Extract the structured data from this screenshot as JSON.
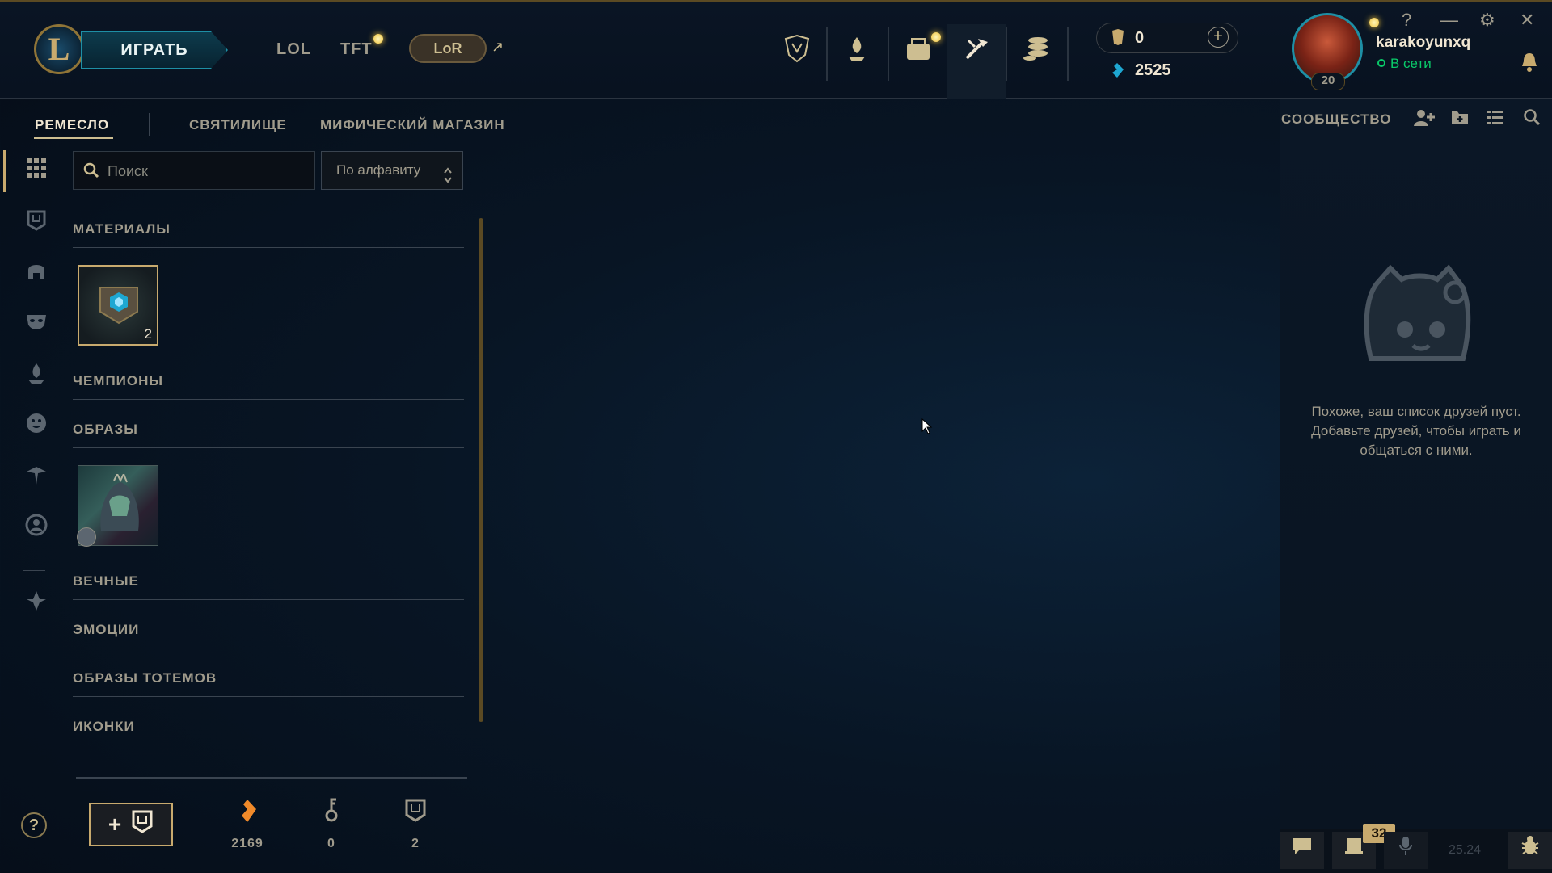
{
  "header": {
    "play_label": "ИГРАТЬ",
    "logo_letter": "L",
    "nav": [
      "LOL",
      "TFT"
    ],
    "lor_label": "LoR",
    "external_arrow": "↗",
    "icons": [
      "worlds-icon",
      "champion-mastery-icon",
      "loot-icon",
      "crafting-icon",
      "store-icon"
    ],
    "rp": "0",
    "be": "2525"
  },
  "profile": {
    "name": "karakoyunxq",
    "status": "В сети",
    "level": "20"
  },
  "window_controls": {
    "help": "?",
    "minimize": "—",
    "settings": "⚙",
    "close": "✕"
  },
  "subnav": {
    "tabs": [
      "РЕМЕСЛО",
      "СВЯТИЛИЩЕ",
      "МИФИЧЕСКИЙ МАГАЗИН"
    ],
    "active": "РЕМЕСЛО"
  },
  "search": {
    "placeholder": "Поиск"
  },
  "sort": {
    "selected": "По алфавиту"
  },
  "sections": {
    "materials": "МАТЕРИАЛЫ",
    "materials_count": "2",
    "champions": "ЧЕМПИОНЫ",
    "skins": "ОБРАЗЫ",
    "eternals": "ВЕЧНЫЕ",
    "emotes": "ЭМОЦИИ",
    "ward_skins": "ОБРАЗЫ ТОТЕМОВ",
    "icons": "ИКОНКИ"
  },
  "footer": {
    "add_label": "+",
    "help": "?",
    "stats": [
      {
        "name": "orange-essence",
        "value": "2169",
        "color": "#f08a2a"
      },
      {
        "name": "keys",
        "value": "0",
        "color": "#a09b8c"
      },
      {
        "name": "chests",
        "value": "2",
        "color": "#a09b8c"
      }
    ]
  },
  "social": {
    "title": "СООБЩЕСТВО",
    "empty_message": "Похоже, ваш список друзей пуст. Добавьте друзей, чтобы играть и общаться с ними.",
    "badge_count": "32",
    "version": "25.24"
  },
  "colors": {
    "gold": "#c8aa6e",
    "teal": "#1e8fa5",
    "online": "#0acb6a"
  }
}
